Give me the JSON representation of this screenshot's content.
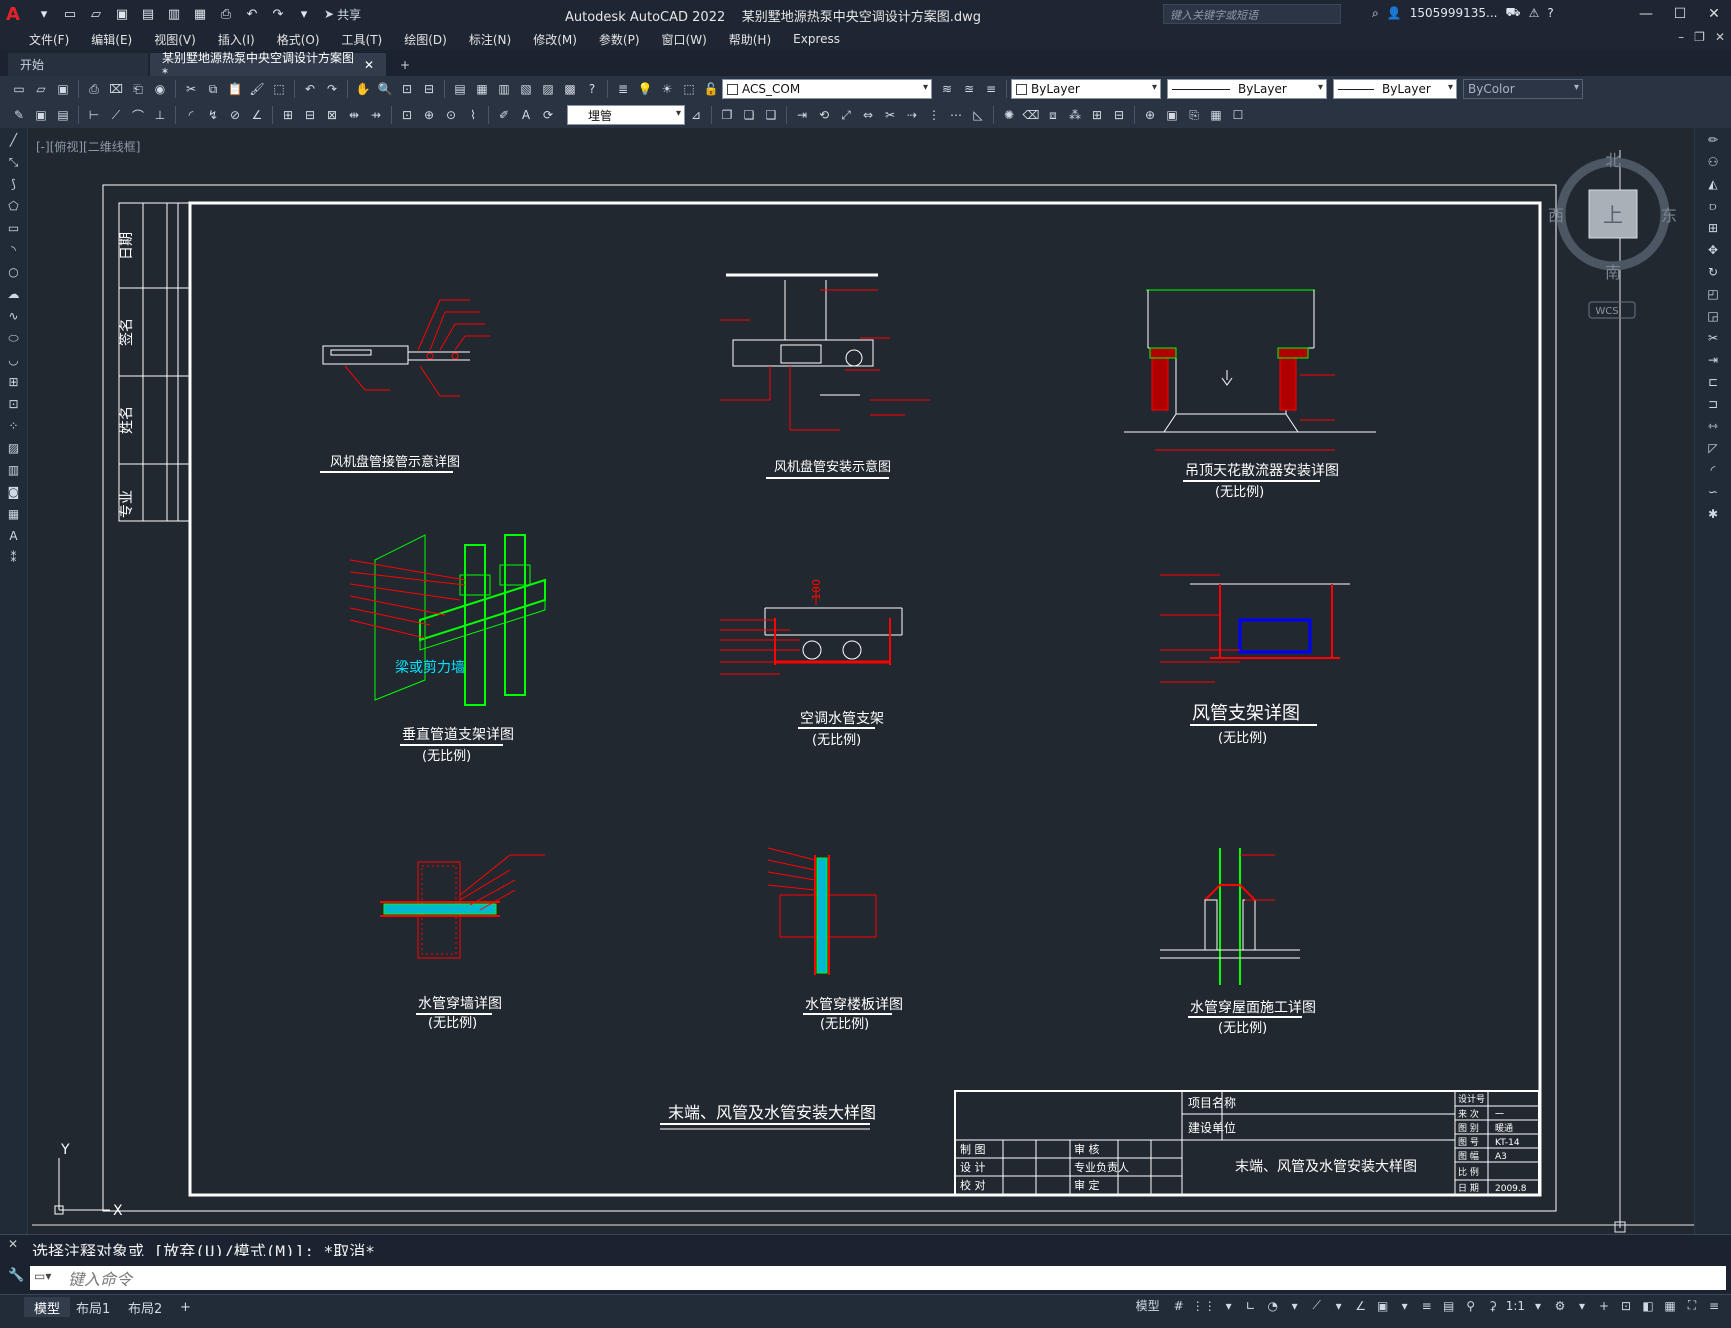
{
  "titlebar": {
    "app_name": "Autodesk AutoCAD 2022",
    "file_name": "某别墅地源热泵中央空调设计方案图.dwg",
    "share_label": "共享",
    "search_placeholder": "键入关键字或短语",
    "user": "1505999135..."
  },
  "menu": [
    "文件(F)",
    "编辑(E)",
    "视图(V)",
    "插入(I)",
    "格式(O)",
    "工具(T)",
    "绘图(D)",
    "标注(N)",
    "修改(M)",
    "参数(P)",
    "窗口(W)",
    "帮助(H)",
    "Express"
  ],
  "tabs": {
    "start": "开始",
    "drawing": "某别墅地源热泵中央空调设计方案图*",
    "add": "+"
  },
  "toolbar": {
    "layer_name": "ACS_COM",
    "color": "ByLayer",
    "linetype": "ByLayer",
    "lineweight": "ByLayer",
    "plotstyle": "ByColor",
    "dim_layer": "埋管"
  },
  "viewport_label": "[-][俯视][二维线框]",
  "viewcube": {
    "north": "北",
    "south": "南",
    "east": "东",
    "west": "西",
    "top": "上",
    "wcs": "WCS"
  },
  "ucs": {
    "x": "X",
    "y": "Y"
  },
  "sheet": {
    "side_labels": [
      "日期",
      "签名",
      "姓名",
      "专业"
    ],
    "details": [
      {
        "title": "风机盘管接管示意详图",
        "scale": ""
      },
      {
        "title": "风机盘管安装示意图",
        "scale": ""
      },
      {
        "title": "吊顶天花散流器安装详图",
        "scale": "(无比例)"
      },
      {
        "title": "垂直管道支架详图",
        "scale": "(无比例)"
      },
      {
        "title": "空调水管支架",
        "scale": "(无比例)"
      },
      {
        "title": "风管支架详图",
        "scale": "(无比例)"
      },
      {
        "title": "水管穿墙详图",
        "scale": "(无比例)"
      },
      {
        "title": "水管穿楼板详图",
        "scale": "(无比例)"
      },
      {
        "title": "水管穿屋面施工详图",
        "scale": "(无比例)"
      }
    ],
    "wall_label": "梁或剪力墙",
    "dim_value": "100",
    "sheet_title": "末端、风管及水管安装大样图",
    "title_block": {
      "project_label": "项目名称",
      "client_label": "建设单位",
      "drawing_name": "末端、风管及水管安装大样图",
      "left_rows": [
        "制 图",
        "设 计",
        "校 对"
      ],
      "mid_rows": [
        "审 核",
        "专业负责人",
        "审 定"
      ],
      "right_labels": [
        "设计号",
        "来 次",
        "图 别",
        "图 号",
        "图 幅",
        "比 例",
        "日 期"
      ],
      "right_values": [
        "",
        "一",
        "暖通",
        "KT-14",
        "A3",
        "",
        "2009.8"
      ]
    }
  },
  "command": {
    "history": "选择注释对象或 [放弃(U)/模式(M)]: *取消*",
    "placeholder": "键入命令"
  },
  "layouts": [
    "模型",
    "布局1",
    "布局2",
    "+"
  ],
  "status": {
    "model_label": "模型",
    "scale": "1:1"
  }
}
